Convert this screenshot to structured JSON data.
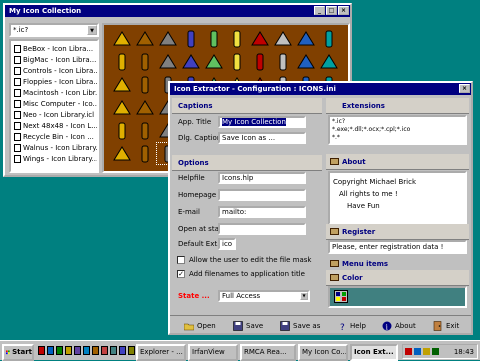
{
  "bg_window": {
    "title": "My Icon Collection",
    "filter_value": "*.ic?",
    "files": [
      "BeBox - Icon Libra...",
      "BigMac - Icon Libra...",
      "Controls - Icon Libra...",
      "Floppies - Icon Libra...",
      "Macintosh - Icon Libr...",
      "Misc Computer - Ico...",
      "Neo - Icon Library.icl",
      "Next 48x48 - Icon L...",
      "Recycle Bin - Icon ...",
      "Walnus - Icon Library...",
      "Wings - Icon Library..."
    ]
  },
  "dialog": {
    "title": "Icon Extractor - Configuration : ICONS.ini",
    "captions": {
      "heading": "Captions",
      "app_title_label": "App. Title",
      "app_title_value": "My Icon Collection",
      "dlg_caption_label": "Dlg. Caption",
      "dlg_caption_value": "Save Icon as ..."
    },
    "options": {
      "heading": "Options",
      "helpfile_label": "Helpfile",
      "helpfile_value": "Icons.hlp",
      "homepage_label": "Homepage",
      "homepage_value": "",
      "email_label": "E-mail",
      "email_value": "mailto:",
      "open_at_start_label": "Open at start",
      "open_at_start_value": "",
      "default_ext_label": "Default Ext.",
      "default_ext_value": "ico",
      "allow_edit_label": "Allow the user to edit the file mask",
      "add_filenames_label": "Add filenames to application title",
      "state_label": "State ...",
      "state_value": "Full Access"
    },
    "extensions": {
      "heading": "Extensions",
      "value_line1": "*.ic?",
      "value_line2": "*.exe;*.dll;*.ocx;*.cpl;*.ico",
      "value_line3": "*.*"
    },
    "about": {
      "heading": "About",
      "line1": "Copyright Michael Brick",
      "line2": "All rights to me !",
      "line3": "Have Fun"
    },
    "register": {
      "heading": "Register",
      "value": "Please, enter registration data !"
    },
    "menu_items": {
      "heading": "Menu items"
    },
    "color": {
      "heading": "Color"
    },
    "toolbar": {
      "open": "Open",
      "save": "Save",
      "save_as": "Save as",
      "help": "Help",
      "about": "About",
      "exit": "Exit"
    }
  },
  "taskbar": {
    "start": "Start",
    "tasks": [
      "Explorer - ...",
      "IrfanView",
      "RMCA Rea...",
      "My Icon Co...",
      "Icon Ext..."
    ],
    "clock": "18:43"
  },
  "colors": {
    "title_bar": "#000080",
    "icon_pane": "#804000",
    "desktop": "#008080",
    "color_swatch": "#408080"
  }
}
